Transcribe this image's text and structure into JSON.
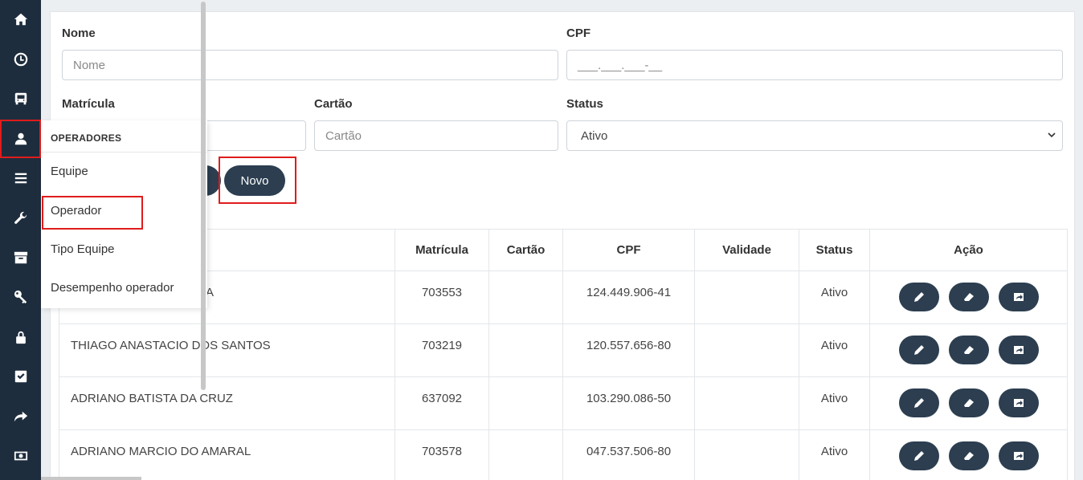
{
  "sidebar": {
    "icons": [
      "home-icon",
      "clock-icon",
      "bus-icon",
      "user-icon",
      "menu-icon",
      "wrench-icon",
      "archive-icon",
      "key-icon",
      "lock-icon",
      "check-icon",
      "share-icon",
      "money-icon"
    ]
  },
  "form": {
    "nome_label": "Nome",
    "nome_placeholder": "Nome",
    "cpf_label": "CPF",
    "cpf_placeholder": "___.___.___-__",
    "matricula_label": "Matrícula",
    "cartao_label": "Cartão",
    "cartao_placeholder": "Cartão",
    "status_label": "Status",
    "status_value": "Ativo",
    "novo_label": "Novo"
  },
  "flyout": {
    "title": "OPERADORES",
    "items": [
      "Equipe",
      "Operador",
      "Tipo Equipe",
      "Desempenho operador"
    ]
  },
  "table": {
    "headers": [
      "",
      "Matrícula",
      "Cartão",
      "CPF",
      "Validade",
      "Status",
      "Ação"
    ],
    "rows": [
      {
        "name": "A",
        "matricula": "703553",
        "cartao": "",
        "cpf": "124.449.906-41",
        "validade": "",
        "status": "Ativo"
      },
      {
        "name": "THIAGO ANASTACIO DOS SANTOS",
        "matricula": "703219",
        "cartao": "",
        "cpf": "120.557.656-80",
        "validade": "",
        "status": "Ativo"
      },
      {
        "name": "ADRIANO BATISTA DA CRUZ",
        "matricula": "637092",
        "cartao": "",
        "cpf": "103.290.086-50",
        "validade": "",
        "status": "Ativo"
      },
      {
        "name": "ADRIANO MARCIO DO AMARAL",
        "matricula": "703578",
        "cartao": "",
        "cpf": "047.537.506-80",
        "validade": "",
        "status": "Ativo"
      }
    ]
  },
  "colors": {
    "sidebar_bg": "#1e2d3d",
    "button_bg": "#2c3e50",
    "highlight": "#e01c1c"
  }
}
